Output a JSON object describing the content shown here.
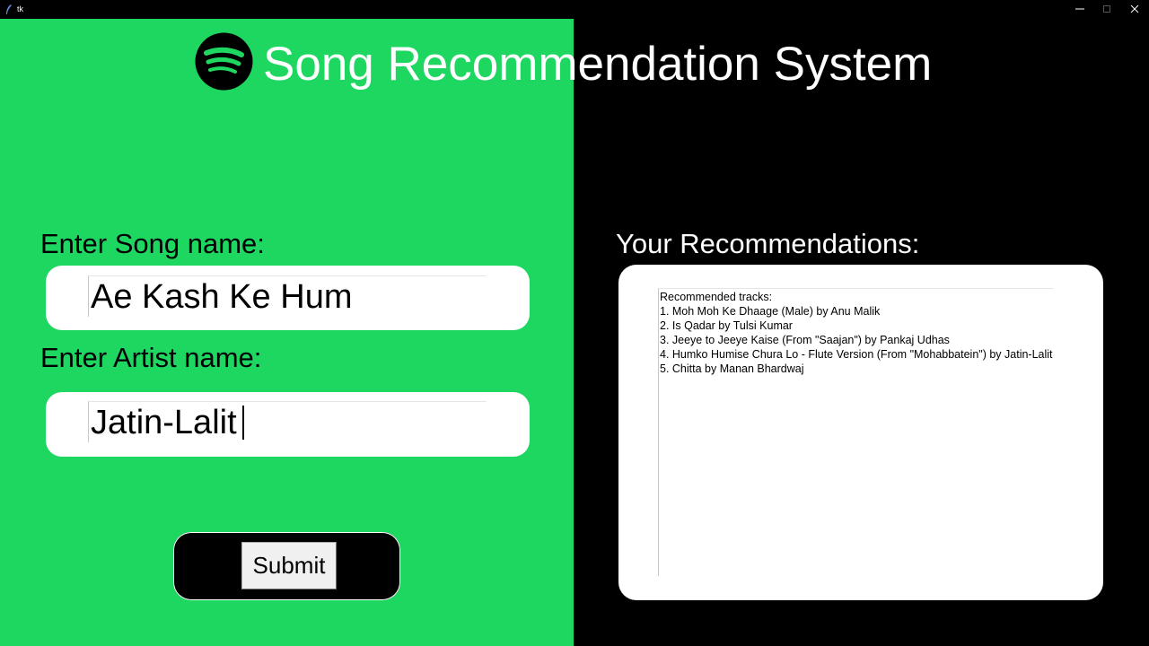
{
  "window": {
    "title": "tk",
    "icons": [
      "feather-icon",
      "minimize-icon",
      "maximize-icon",
      "close-icon"
    ]
  },
  "colors": {
    "left_panel": "#1ed760",
    "right_panel": "#000000",
    "card": "#ffffff"
  },
  "header": {
    "title": "Song Recommendation System",
    "logo_icon": "spotify-logo-icon"
  },
  "form": {
    "song_label": "Enter Song name:",
    "song_value": "Ae Kash Ke Hum",
    "artist_label": "Enter Artist name:",
    "artist_value": "Jatin-Lalit",
    "submit_label": "Submit"
  },
  "recommendations": {
    "label": "Your Recommendations:",
    "heading": "Recommended tracks:",
    "items": [
      "1. Moh Moh Ke Dhaage (Male) by Anu Malik",
      "2. Is Qadar by Tulsi Kumar",
      "3. Jeeye to Jeeye Kaise (From \"Saajan\") by Pankaj Udhas",
      "4. Humko Humise Chura Lo - Flute Version (From \"Mohabbatein\") by Jatin-Lalit",
      "5. Chitta by Manan Bhardwaj"
    ]
  }
}
